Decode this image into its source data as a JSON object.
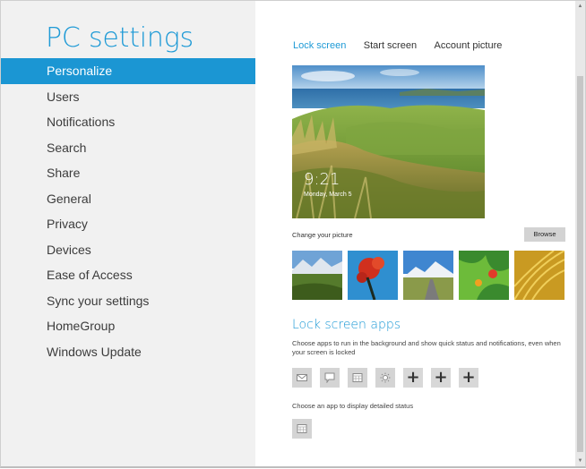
{
  "nav": {
    "title": "PC settings",
    "items": [
      {
        "label": "Personalize",
        "selected": true
      },
      {
        "label": "Users"
      },
      {
        "label": "Notifications"
      },
      {
        "label": "Search"
      },
      {
        "label": "Share"
      },
      {
        "label": "General"
      },
      {
        "label": "Privacy"
      },
      {
        "label": "Devices"
      },
      {
        "label": "Ease of Access"
      },
      {
        "label": "Sync your settings"
      },
      {
        "label": "HomeGroup"
      },
      {
        "label": "Windows Update"
      }
    ]
  },
  "tabs": [
    {
      "label": "Lock screen",
      "active": true
    },
    {
      "label": "Start screen"
    },
    {
      "label": "Account picture"
    }
  ],
  "preview": {
    "time": "9:21",
    "date": "Monday, March 5"
  },
  "change_picture": {
    "label": "Change your picture",
    "browse_label": "Browse"
  },
  "lock_apps": {
    "title": "Lock screen apps",
    "description": "Choose apps to run in the background and show quick status and notifications, even when your screen is locked",
    "slots": [
      {
        "icon": "mail-icon"
      },
      {
        "icon": "messaging-icon"
      },
      {
        "icon": "calendar-icon"
      },
      {
        "icon": "weather-icon"
      },
      {
        "icon": "plus-icon",
        "glyph": "+"
      },
      {
        "icon": "plus-icon",
        "glyph": "+"
      },
      {
        "icon": "plus-icon",
        "glyph": "+"
      }
    ],
    "detail_description": "Choose an app to display detailed status",
    "detail_icon": "calendar-icon"
  },
  "colors": {
    "accent": "#1e9ad6",
    "selected_bg": "#1b96d3",
    "nav_bg": "#f1f1f1"
  }
}
